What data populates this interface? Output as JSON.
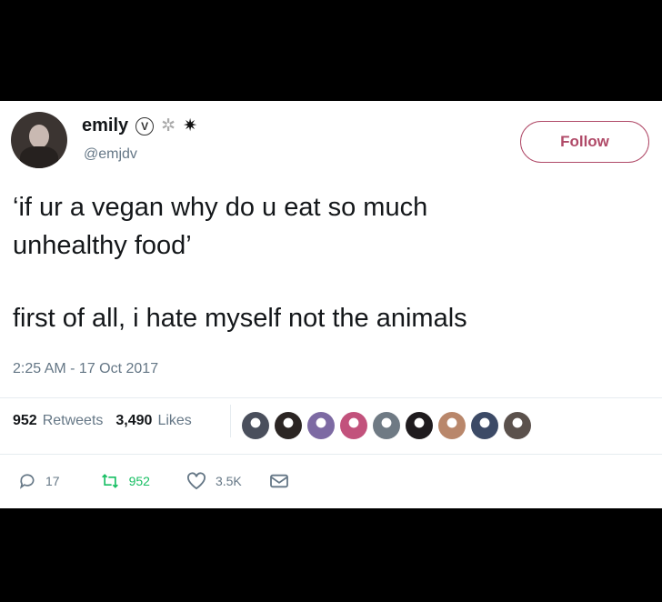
{
  "user": {
    "name": "emily",
    "handle": "@emjdv",
    "badges": [
      "verified-v-icon",
      "spider-web-icon",
      "spider-icon"
    ]
  },
  "follow_label": "Follow",
  "tweet": {
    "quote": "‘if ur a vegan why do u eat so much\nunhealthy food’",
    "reply": "first of all, i hate myself not the animals",
    "timestamp": "2:25 AM - 17 Oct 2017"
  },
  "stats": {
    "retweets_count": "952",
    "retweets_label": "Retweets",
    "likes_count": "3,490",
    "likes_label": "Likes"
  },
  "liker_avatar_colors": [
    "#4a4f5c",
    "#2b2523",
    "#7d6aa3",
    "#c2527c",
    "#6f7a84",
    "#1f1b1e",
    "#b9876b",
    "#3c4a66",
    "#5b514c"
  ],
  "actions": {
    "reply_count": "17",
    "retweet_count": "952",
    "like_count": "3.5K"
  },
  "colors": {
    "follow_accent": "#b04a68",
    "retweet_green": "#17bf63",
    "secondary_text": "#657786"
  }
}
